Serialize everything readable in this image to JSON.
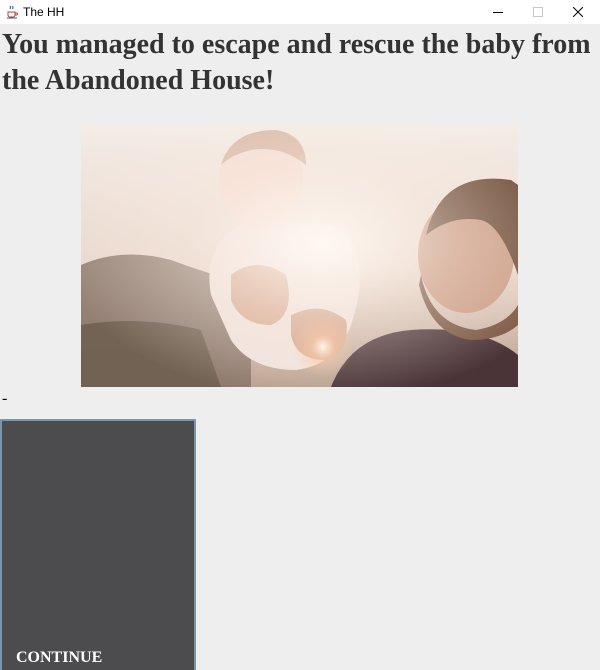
{
  "window": {
    "title": "The HH",
    "icon": "java-cup-icon",
    "controls": [
      "minimize-icon",
      "maximize-icon",
      "close-icon"
    ]
  },
  "main": {
    "heading": "You managed to escape and rescue the baby from the Abandoned House!",
    "image_icon": "photo-father-holding-baby",
    "separator_text": "-",
    "continue_label": "CONTINUE"
  },
  "colors": {
    "background": "#eeeeee",
    "heading_text": "#333333",
    "button_bg": "#4c4c4e",
    "button_border": "#7a96ad",
    "button_text": "#ffffff"
  }
}
